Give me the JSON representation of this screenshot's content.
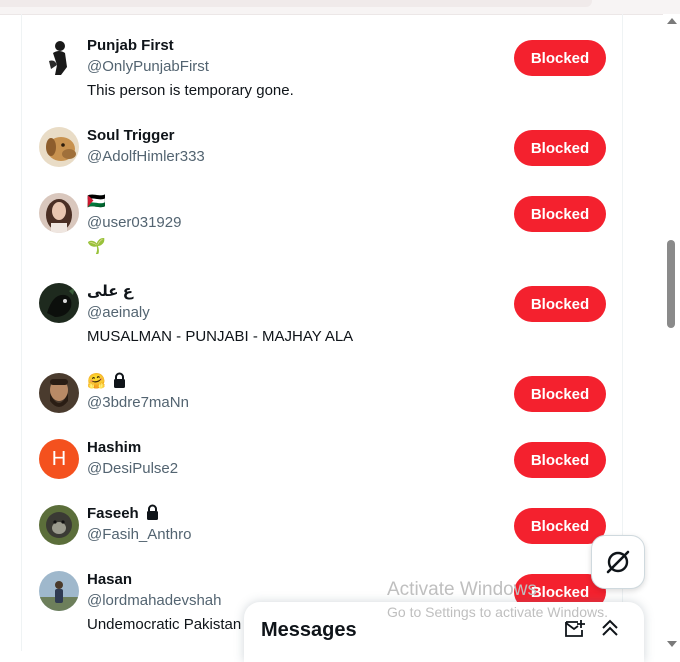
{
  "users": [
    {
      "name": "Punjab First",
      "handle": "@OnlyPunjabFirst",
      "bio": "This person is temporary gone.",
      "button": "Blocked",
      "avatar_icon": "dark-figure-avatar"
    },
    {
      "name": "Soul Trigger",
      "handle": "@AdolfHimler333",
      "bio": "",
      "button": "Blocked",
      "avatar_icon": "dog-avatar"
    },
    {
      "name": "🇵🇸",
      "handle": "@user031929",
      "bio": "🌱",
      "button": "Blocked",
      "avatar_icon": "girl-avatar"
    },
    {
      "name": "ع علی",
      "handle": "@aeinaly",
      "bio": "MUSALMAN - PUNJABI - MAJHAY ALA",
      "button": "Blocked",
      "avatar_icon": "dark-bird-avatar"
    },
    {
      "name": "🤗",
      "handle": "@3bdre7maNn",
      "bio": "",
      "button": "Blocked",
      "avatar_icon": "bearded-man-avatar"
    },
    {
      "name": "Hashim",
      "handle": "@DesiPulse2",
      "bio": "",
      "button": "Blocked",
      "avatar_letter": "H",
      "avatar_color": "#f4511e"
    },
    {
      "name": "Faseeh",
      "handle": "@Fasih_Anthro",
      "bio": "",
      "button": "Blocked",
      "avatar_icon": "monkey-avatar"
    },
    {
      "name": "Hasan",
      "handle": "@lordmahadevshah",
      "bio": "Undemocratic Pakistan",
      "button": "Blocked",
      "avatar_icon": "person-outdoors-avatar"
    }
  ],
  "messages": {
    "title": "Messages"
  },
  "watermark": {
    "line1": "Activate Windows",
    "line2": "Go to Settings to activate Windows."
  },
  "colors": {
    "blocked": "#f4212e",
    "handle": "#536471"
  }
}
